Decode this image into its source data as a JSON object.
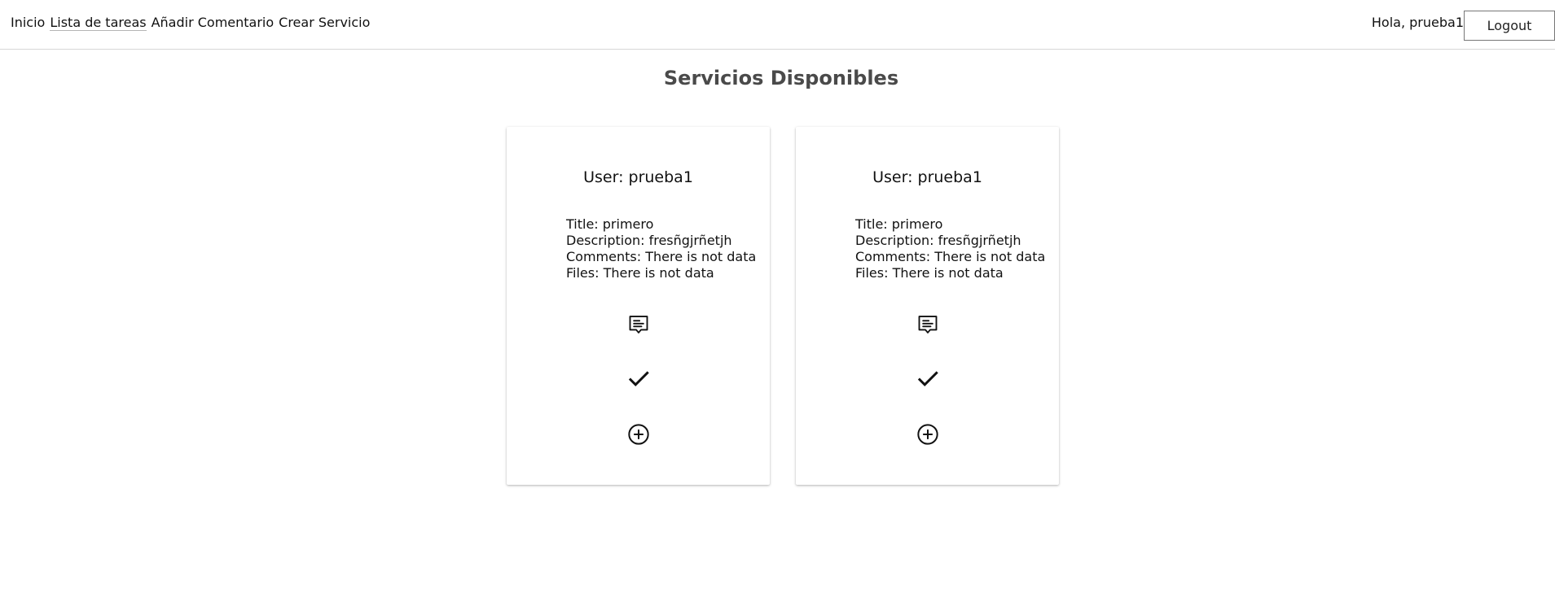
{
  "nav": {
    "links": [
      {
        "label": "Inicio"
      },
      {
        "label": "Lista de tareas"
      },
      {
        "label": "Añadir Comentario"
      },
      {
        "label": "Crear Servicio"
      }
    ],
    "greeting": "Hola, prueba1",
    "logout_label": "Logout"
  },
  "main": {
    "title": "Servicios Disponibles",
    "cards": [
      {
        "user": "User: prueba1",
        "title": "Title: primero",
        "description": "Description: fresñgjrñetjh",
        "comments": "Comments: There is not data",
        "files": "Files: There is not data",
        "icons": [
          "comment-icon",
          "check-icon",
          "add-circle-icon"
        ]
      },
      {
        "user": "User: prueba1",
        "title": "Title: primero",
        "description": "Description: fresñgjrñetjh",
        "comments": "Comments: There is not data",
        "files": "Files: There is not data",
        "icons": [
          "comment-icon",
          "check-icon",
          "add-circle-icon"
        ]
      }
    ]
  }
}
